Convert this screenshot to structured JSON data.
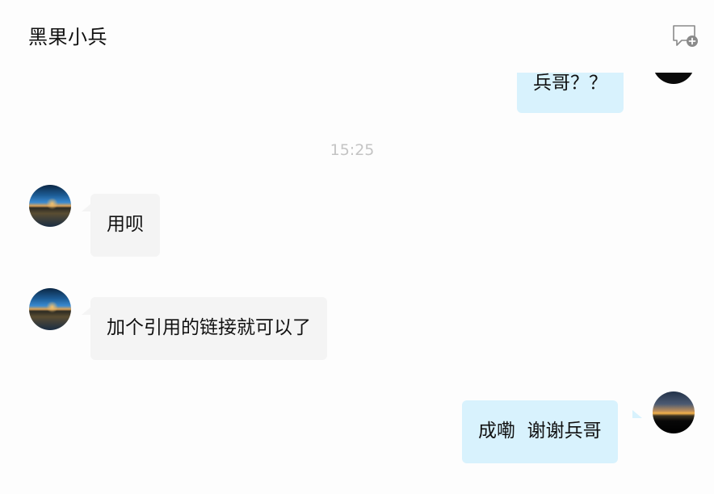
{
  "header": {
    "title": "黑果小兵",
    "new_chat_icon": "chat-bubble-plus-icon"
  },
  "messages": [
    {
      "direction": "out",
      "text": "兵哥？？",
      "avatar": "dark-avatar"
    },
    {
      "type": "timestamp",
      "text": "15:25"
    },
    {
      "direction": "in",
      "text": "用呗",
      "avatar": "landscape-avatar"
    },
    {
      "direction": "in",
      "text": "加个引用的链接就可以了",
      "avatar": "landscape-avatar"
    },
    {
      "direction": "out",
      "text": "成嘞  谢谢兵哥",
      "avatar": "sunset-avatar"
    }
  ],
  "colors": {
    "incoming_bubble": "#f4f4f4",
    "outgoing_bubble": "#d8f2fd",
    "timestamp": "#c4c4c4",
    "background": "#fdfdfd"
  }
}
